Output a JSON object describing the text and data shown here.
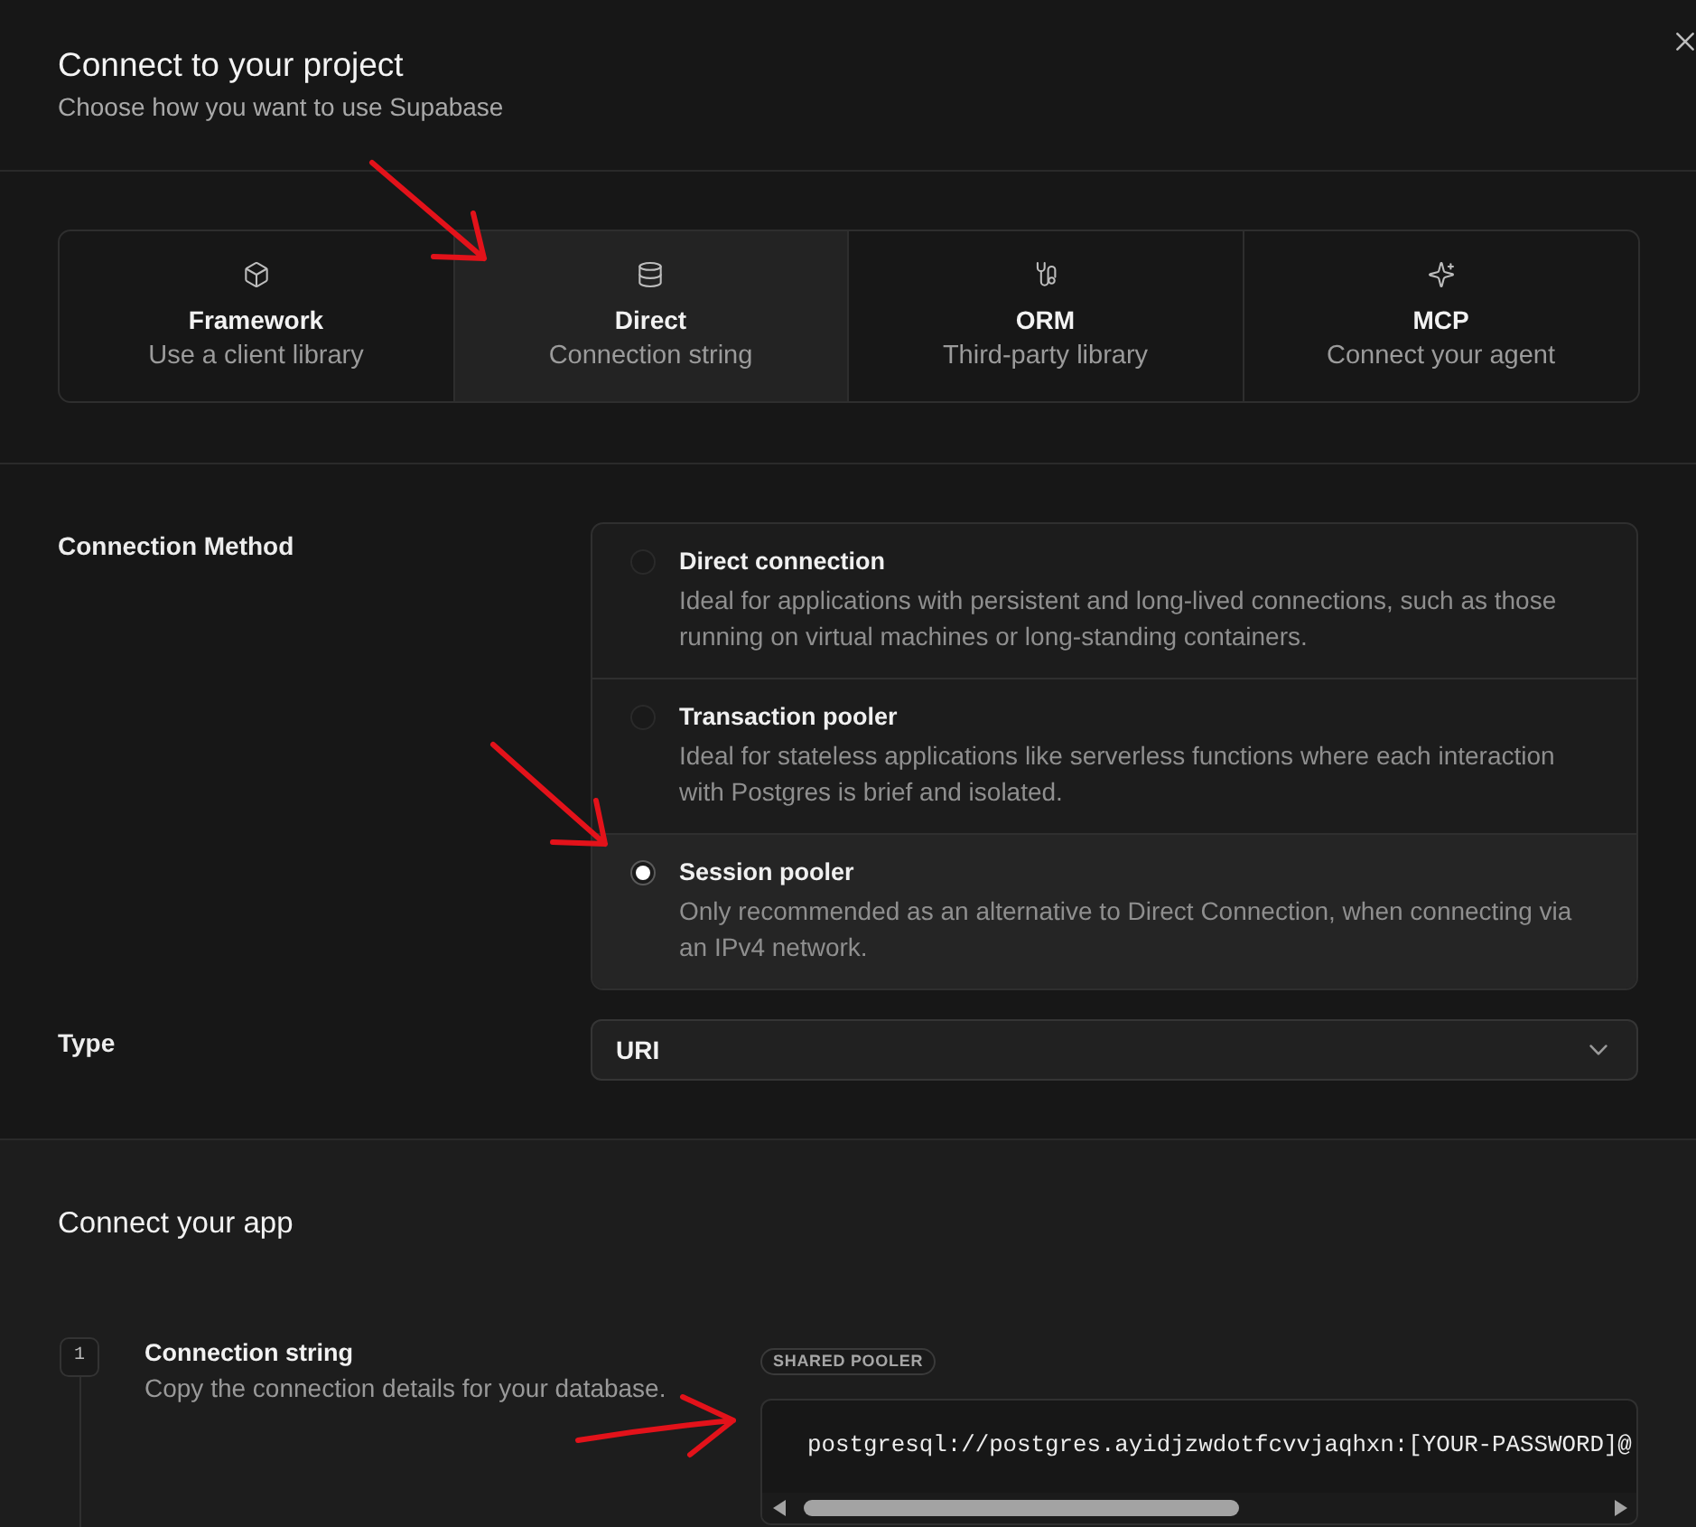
{
  "dialog": {
    "title": "Connect to your project",
    "subtitle": "Choose how you want to use Supabase"
  },
  "tabs": [
    {
      "title": "Framework",
      "subtitle": "Use a client library",
      "selected": false
    },
    {
      "title": "Direct",
      "subtitle": "Connection string",
      "selected": true
    },
    {
      "title": "ORM",
      "subtitle": "Third-party library",
      "selected": false
    },
    {
      "title": "MCP",
      "subtitle": "Connect your agent",
      "selected": false
    }
  ],
  "connection_method": {
    "label": "Connection Method",
    "options": [
      {
        "title": "Direct connection",
        "description": "Ideal for applications with persistent and long-lived connections, such as those running on virtual machines or long-standing containers.",
        "selected": false
      },
      {
        "title": "Transaction pooler",
        "description": "Ideal for stateless applications like serverless functions where each interaction with Postgres is brief and isolated.",
        "selected": false
      },
      {
        "title": "Session pooler",
        "description": "Only recommended as an alternative to Direct Connection, when connecting via an IPv4 network.",
        "selected": true
      }
    ]
  },
  "type": {
    "label": "Type",
    "value": "URI"
  },
  "connect_app": {
    "title": "Connect your app",
    "steps": [
      {
        "number": "1",
        "title": "Connection string",
        "description": "Copy the connection details for your database.",
        "badge": "SHARED POOLER",
        "code": "postgresql://postgres.ayidjzwdotfcvvjaqhxn:[YOUR-PASSWORD]@"
      }
    ]
  }
}
